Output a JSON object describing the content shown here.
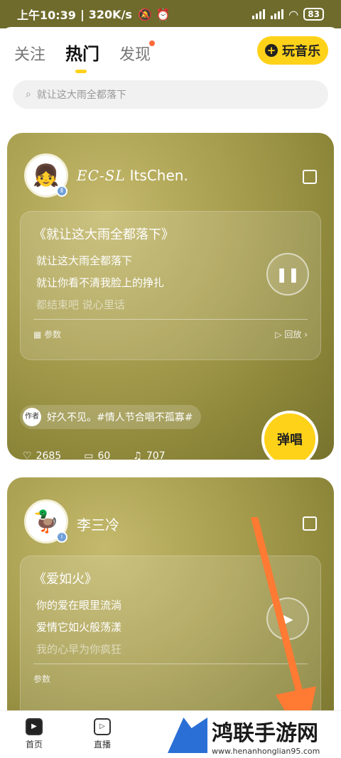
{
  "status_bar": {
    "time": "上午10:39",
    "speed": "320K/s",
    "battery": "83"
  },
  "tabs": [
    {
      "label": "关注"
    },
    {
      "label": "热门"
    },
    {
      "label": "发现"
    }
  ],
  "play_music_button": {
    "label": "玩音乐"
  },
  "search": {
    "placeholder": "就让这大雨全都落下"
  },
  "cards": [
    {
      "user_script": "EC-SL",
      "user_name": "ItsChen.",
      "song_title": "《就让这大雨全都落下》",
      "lyrics": [
        "就让这大雨全都落下",
        "就让你看不清我脸上的挣扎",
        "都结束吧 说心里话"
      ],
      "param_label": "参数",
      "replay_label": "回放",
      "topic_tag": "作者",
      "topic_text": "好久不见。#情人节合唱不孤寡#",
      "likes": "2685",
      "comments": "60",
      "duets": "707",
      "sing_label": "弹唱"
    },
    {
      "user_name": "李三冷",
      "song_title": "《爱如火》",
      "lyrics": [
        "你的爱在眼里流淌",
        "爱情它如火般荡漾",
        "我的心早为你疯狂"
      ],
      "param_label": "参数"
    }
  ],
  "bottom_nav": [
    {
      "label": "首页"
    },
    {
      "label": "直播"
    }
  ],
  "watermark": {
    "brand": "鸿联手游网",
    "url": "www.henanhonglian95.com"
  },
  "colors": {
    "accent": "#ffd21a",
    "arrow": "#ff7a33",
    "card": "#9c9445"
  },
  "icons": [
    "search-icon",
    "share-icon",
    "pause-icon",
    "play-icon",
    "heartbeat-icon",
    "comment-icon",
    "duet-icon",
    "home-icon",
    "live-icon"
  ]
}
